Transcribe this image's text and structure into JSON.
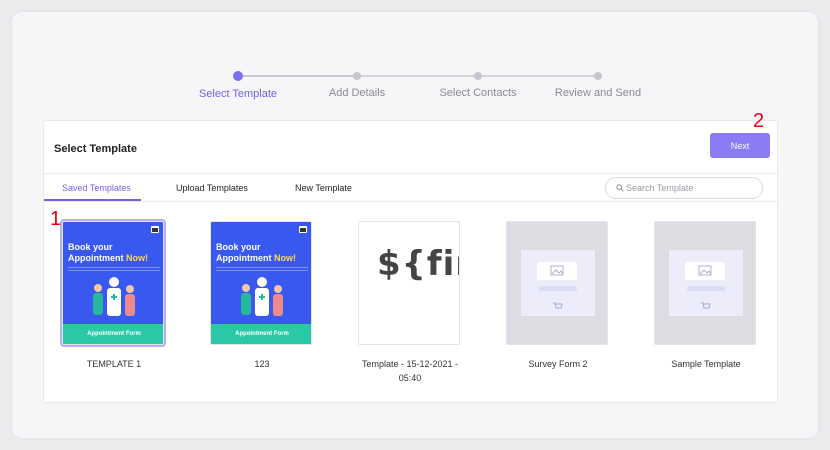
{
  "stepper": {
    "steps": [
      {
        "label": "Select Template"
      },
      {
        "label": "Add Details"
      },
      {
        "label": "Select Contacts"
      },
      {
        "label": "Review and Send"
      }
    ],
    "active_step": 1
  },
  "card": {
    "title": "Select Template",
    "next_label": "Next"
  },
  "tabs": [
    {
      "label": "Saved Templates"
    },
    {
      "label": "Upload Templates"
    },
    {
      "label": "New Template"
    }
  ],
  "search": {
    "placeholder": "Search Template"
  },
  "templates": [
    {
      "name": "TEMPLATE 1",
      "thumb_title_1": "Book your",
      "thumb_title_2": "Appointment",
      "thumb_title_now": "Now!",
      "thumb_band": "Appointment Form"
    },
    {
      "name": "123",
      "thumb_title_1": "Book your",
      "thumb_title_2": "Appointment",
      "thumb_title_now": "Now!",
      "thumb_band": "Appointment Form"
    },
    {
      "name_1": "Template - 15-12-2021 -",
      "name_2": "05:40",
      "thumb_text": "${firs"
    },
    {
      "name": "Survey Form 2"
    },
    {
      "name": "Sample Template"
    }
  ],
  "markers": [
    "1",
    "2"
  ],
  "colors": {
    "accent": "#7b6ef0",
    "button": "#8b7cf6",
    "poster_bg": "#3858f0",
    "poster_band": "#29c9a6"
  }
}
